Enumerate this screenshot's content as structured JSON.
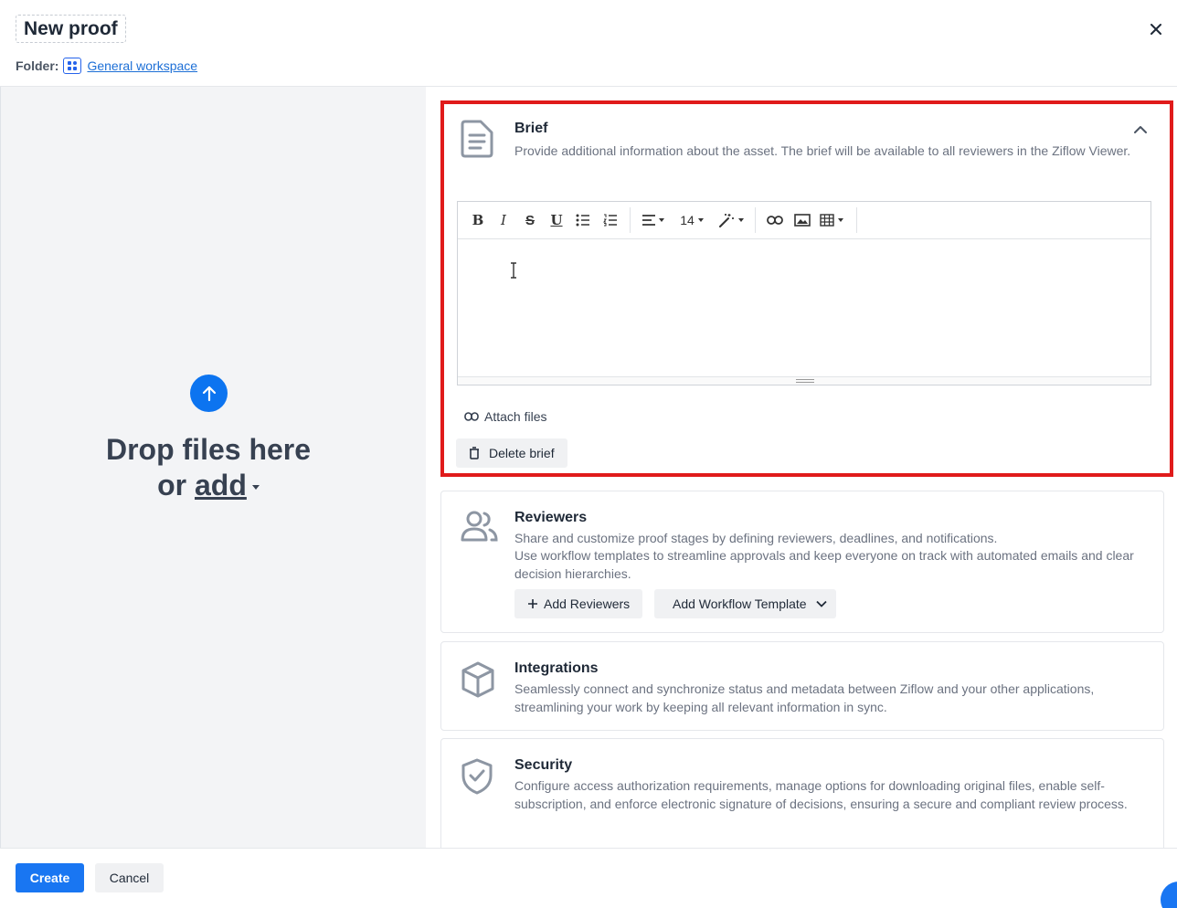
{
  "header": {
    "title": "New proof",
    "folder_label": "Folder:",
    "folder_name": "General workspace"
  },
  "upload": {
    "line1": "Drop files here",
    "line2_prefix": "or ",
    "add_label": "add"
  },
  "brief": {
    "title": "Brief",
    "description": "Provide additional information about the asset. The brief will be available to all reviewers in the Ziflow Viewer.",
    "toolbar": {
      "bold": "B",
      "italic": "I",
      "strike": "S",
      "underline": "U",
      "font_size": "14"
    },
    "attach_label": "Attach files",
    "delete_label": "Delete brief"
  },
  "reviewers": {
    "title": "Reviewers",
    "desc1": "Share and customize proof stages by defining reviewers, deadlines, and notifications.",
    "desc2": "Use workflow templates to streamline approvals and keep everyone on track with automated emails and clear decision hierarchies.",
    "add_reviewers_label": "Add Reviewers",
    "add_template_label": "Add Workflow Template"
  },
  "integrations": {
    "title": "Integrations",
    "description": "Seamlessly connect and synchronize status and metadata between Ziflow and your other applications, streamlining your work by keeping all relevant information in sync."
  },
  "security": {
    "title": "Security",
    "description": "Configure access authorization requirements, manage options for downloading original files, enable self-subscription, and enforce electronic signature of decisions, ensuring a secure and compliant review process."
  },
  "footer": {
    "create_label": "Create",
    "cancel_label": "Cancel"
  },
  "colors": {
    "primary": "#1976f2",
    "highlight": "#e01b1b",
    "link": "#1d6fd6"
  }
}
